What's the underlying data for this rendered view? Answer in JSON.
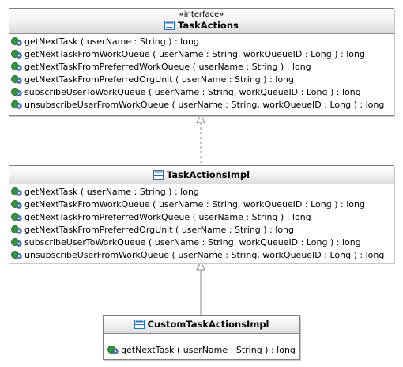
{
  "interface_box": {
    "stereotype": "«interface»",
    "name": "TaskActions",
    "ops": [
      "getNextTask ( userName : String ) : long",
      "getNextTaskFromWorkQueue ( userName : String, workQueueID : Long ) : long",
      "getNextTaskFromPreferredWorkQueue ( userName : String ) : long",
      "getNextTaskFromPreferredOrgUnit ( userName : String ) : long",
      "subscribeUserToWorkQueue ( userName : String, workQueueID : Long ) : long",
      "unsubscribeUserFromWorkQueue ( userName : String, workQueueID : Long ) : long"
    ]
  },
  "impl_box": {
    "name": "TaskActionsImpl",
    "ops": [
      "getNextTask ( userName : String ) : long",
      "getNextTaskFromWorkQueue ( userName : String, workQueueID : Long ) : long",
      "getNextTaskFromPreferredWorkQueue ( userName : String ) : long",
      "getNextTaskFromPreferredOrgUnit ( userName : String ) : long",
      "subscribeUserToWorkQueue ( userName : String, workQueueID : Long ) : long",
      "unsubscribeUserFromWorkQueue ( userName : String, workQueueID : Long ) : long"
    ]
  },
  "custom_box": {
    "name": "CustomTaskActionsImpl",
    "ops": [
      "getNextTask ( userName : String ) : long"
    ]
  },
  "icons": {
    "interface": "interface-icon",
    "class": "class-icon",
    "operation": "public-operation-icon"
  },
  "colors": {
    "border": "#7f7f7f",
    "header_top": "#ffffff",
    "header_bottom": "#dcdcdc",
    "operation_green": "#2e9a3c",
    "class_icon_blue": "#2f6db3"
  }
}
